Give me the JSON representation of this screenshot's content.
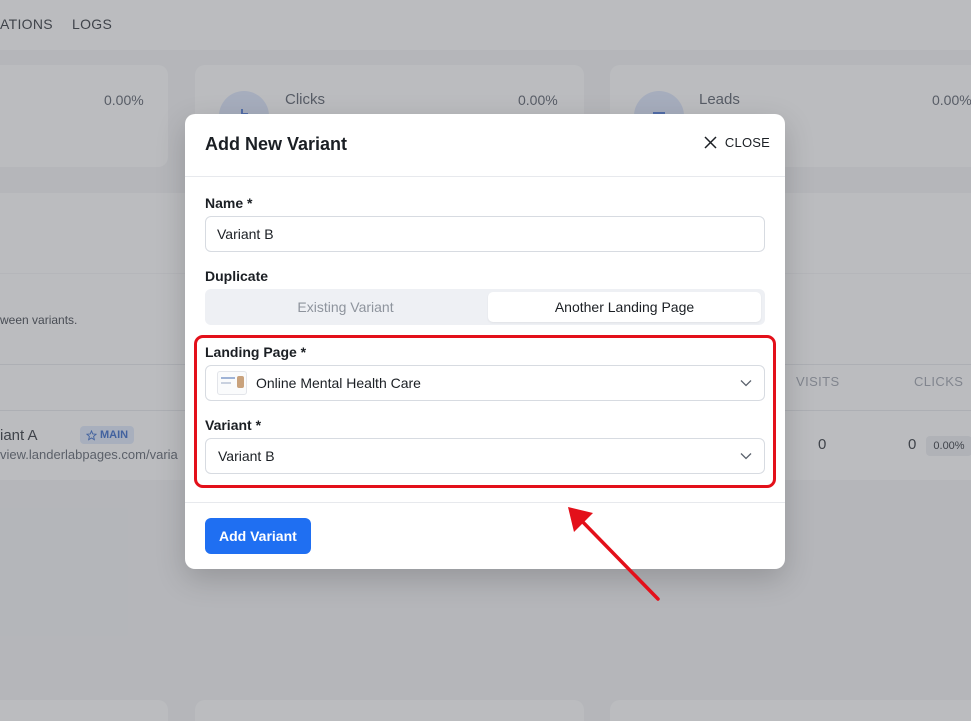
{
  "nav": {
    "items": [
      "ATIONS",
      "LOGS"
    ]
  },
  "stats": [
    {
      "label": "",
      "value": "0.00%"
    },
    {
      "label": "Clicks",
      "value": "0.00%"
    },
    {
      "label": "Leads",
      "value": "0.00%"
    }
  ],
  "background": {
    "description_fragment": "ween variants.",
    "columns": {
      "visits": "VISITS",
      "clicks": "CLICKS"
    },
    "row": {
      "name": "iant A",
      "badge": "MAIN",
      "url": "view.landerlabpages.com/varia",
      "visits": "0",
      "clicks": "0",
      "rate": "0.00%"
    }
  },
  "modal": {
    "title": "Add New Variant",
    "close_label": "CLOSE",
    "name_label": "Name *",
    "name_value": "Variant B",
    "duplicate_label": "Duplicate",
    "duplicate_options": [
      "Existing Variant",
      "Another Landing Page"
    ],
    "duplicate_selected": "Another Landing Page",
    "landing_page_label": "Landing Page *",
    "landing_page_value": "Online Mental Health Care",
    "variant_label": "Variant *",
    "variant_value": "Variant B",
    "submit_label": "Add Variant"
  },
  "colors": {
    "primary": "#1f6ff2",
    "annotation": "#e3101a",
    "badge_text": "#2f64c8"
  },
  "icons": {
    "close": "close-icon",
    "chevron": "chevron-down-icon",
    "star": "star-icon",
    "thumbnail": "landing-page-thumbnail"
  }
}
